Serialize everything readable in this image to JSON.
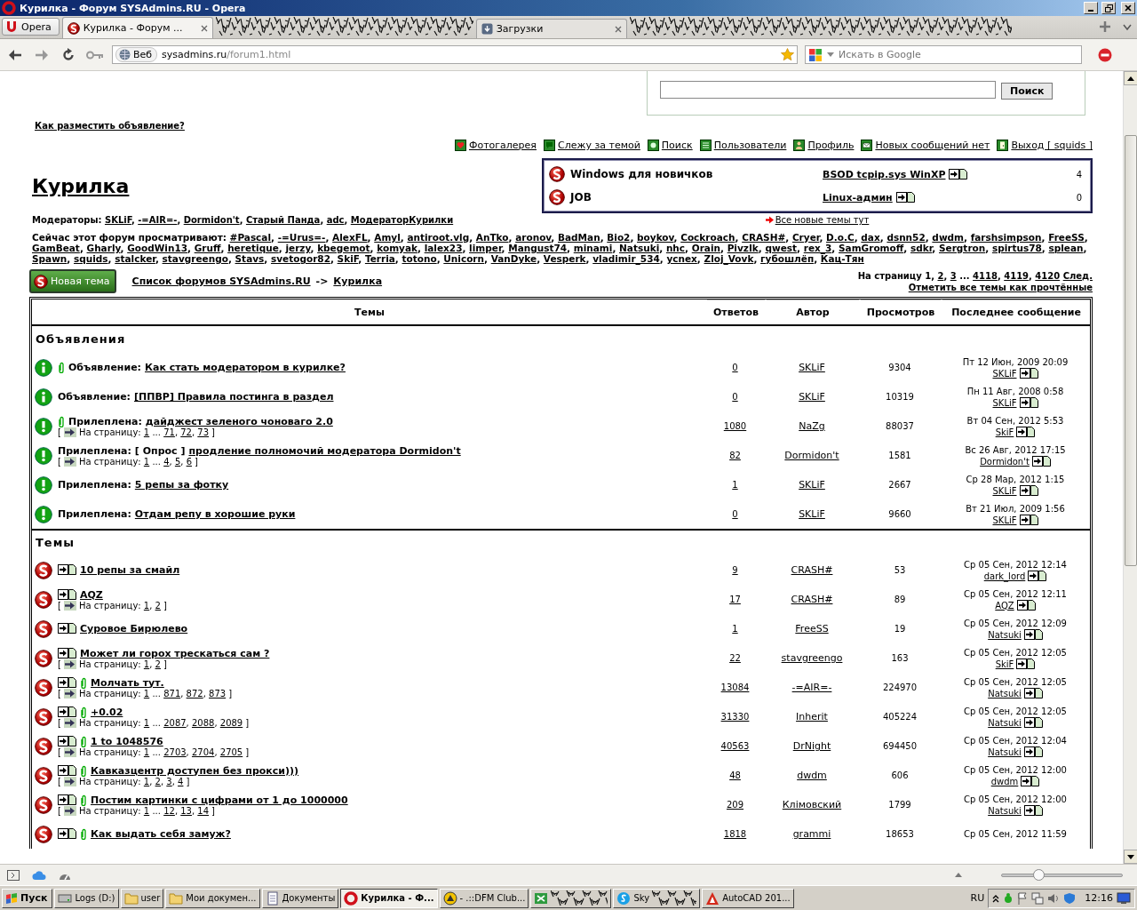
{
  "window": {
    "title": "Курилка - Форум SYSAdmins.RU - Opera"
  },
  "browser": {
    "menu_button": "Opera",
    "tabs": [
      {
        "kind": "tab",
        "label": "Курилка - Форум ...",
        "selected": true
      },
      {
        "kind": "redacted"
      },
      {
        "kind": "tab",
        "label": "Загрузки",
        "selected": false
      },
      {
        "kind": "redacted"
      }
    ],
    "address": {
      "badge": "Веб",
      "host": "sysadmins.ru",
      "path": "/forum1.html"
    },
    "search": {
      "placeholder": "Искать в Google"
    }
  },
  "page": {
    "search_button": "Поиск",
    "post_ad_link": "Как разместить объявление?",
    "nav_links": [
      {
        "kind": "gallery",
        "label": "Фотогалерея"
      },
      {
        "kind": "watch",
        "label": "Слежу за темой"
      },
      {
        "kind": "search",
        "label": "Поиск"
      },
      {
        "kind": "users",
        "label": "Пользователи"
      },
      {
        "kind": "profile",
        "label": "Профиль"
      },
      {
        "kind": "messages",
        "label": "Новых сообщений нет"
      },
      {
        "kind": "logout",
        "label": "Выход [ squids ]"
      }
    ],
    "forum_title": "Курилка",
    "related_forums": [
      {
        "name": "Windows для новичков",
        "last_topic": "BSOD tcpip.sys WinXP",
        "count": "4"
      },
      {
        "name": "JOB",
        "last_topic": "Linux-админ",
        "count": "0"
      }
    ],
    "moderators": {
      "label": "Модераторы:",
      "separator": ", ",
      "names": [
        "SKLiF",
        "-=AIR=-",
        "Dormidon't",
        "Старый Панда",
        "adc",
        "МодераторКурилки"
      ]
    },
    "new_topics_link": "Все новые темы тут",
    "viewers": {
      "label": "Сейчас этот форум просматривают:",
      "separator": ", ",
      "names": [
        "#Pascal",
        "-=Urus=-",
        "AlexFL",
        "Amyl",
        "antiroot.vlg",
        "AnTko",
        "aronov",
        "BadMan",
        "Bio2",
        "boykov",
        "Cockroach",
        "CRASH#",
        "Cryer",
        "D.o.C",
        "dax",
        "dsnn52",
        "dwdm",
        "farshsimpson",
        "FreeSS",
        "GamBeat",
        "Gharly",
        "GoodWin13",
        "Gruff",
        "heretique",
        "jerzy",
        "kbegemot",
        "komyak",
        "lalex23",
        "limper",
        "Mangust74",
        "minami",
        "Natsuki",
        "nhc",
        "Orain",
        "PivzIk",
        "qwest",
        "rex_3",
        "SamGromoff",
        "sdkr",
        "Sergtron",
        "spirtus78",
        "splean",
        "Spawn",
        "squids",
        "stalcker",
        "stavgreengo",
        "Stavs",
        "svetogor82",
        "SkiF",
        "Terria",
        "totono",
        "Unicorn",
        "VanDyke",
        "Vesperk",
        "vladimir_534",
        "ycnex",
        "Zloj_Vovk",
        "губошлёп",
        "Кац-Тян"
      ]
    },
    "new_topic_button": "Новая тема",
    "breadcrumb": {
      "forum_list": "Список форумов SYSAdmins.RU",
      "separator": "->",
      "current": "Курилка"
    },
    "pagination": {
      "label": "На страницу",
      "separator": ", ",
      "pages": [
        {
          "kind": "current",
          "label": "1"
        },
        {
          "kind": "page",
          "label": "2"
        },
        {
          "kind": "page",
          "label": "3"
        },
        {
          "kind": "gap",
          "label": "..."
        },
        {
          "kind": "page",
          "label": "4118"
        },
        {
          "kind": "page",
          "label": "4119"
        },
        {
          "kind": "page",
          "label": "4120"
        }
      ],
      "next": "След."
    },
    "mark_read_link": "Отметить все темы как прочтённые"
  },
  "table": {
    "columns": [
      "Темы",
      "Ответов",
      "Автор",
      "Просмотров",
      "Последнее сообщение"
    ],
    "sections": [
      {
        "title": "Объявления",
        "rows": [
          {
            "kind": "announcement",
            "attachment": true,
            "prefix": "Объявление:",
            "title": "Как стать модератором в курилке?",
            "replies": "0",
            "author": "SKLiF",
            "views": "9304",
            "last_post": {
              "date": "Пт 12 Июн, 2009 20:09",
              "author": "SKLiF"
            }
          },
          {
            "kind": "announcement",
            "attachment": false,
            "prefix": "Объявление:",
            "title": "[ППВР] Правила постинга в раздел",
            "replies": "0",
            "author": "SKLiF",
            "views": "10319",
            "last_post": {
              "date": "Пн 11 Авг, 2008 0:58",
              "author": "SKLiF"
            }
          },
          {
            "kind": "sticky",
            "attachment": true,
            "prefix": "Прилеплена:",
            "title": "дайджест зеленого чоноваго 2.0",
            "jump": {
              "open": "[",
              "label": "На страницу:",
              "separator": ", ",
              "pages": [
                {
                  "kind": "page",
                  "label": "1"
                },
                {
                  "kind": "gap",
                  "label": "..."
                },
                {
                  "kind": "page",
                  "label": "71"
                },
                {
                  "kind": "page",
                  "label": "72"
                },
                {
                  "kind": "page",
                  "label": "73"
                }
              ],
              "close": "]"
            },
            "replies": "1080",
            "author": "NaZg",
            "views": "88037",
            "last_post": {
              "date": "Вт 04 Сен, 2012 5:53",
              "author": "SkiF"
            }
          },
          {
            "kind": "sticky",
            "attachment": false,
            "prefix": "Прилеплена:",
            "poll": "[ Опрос ]",
            "title": "продление полномочий модератора Dormidon't",
            "jump": {
              "open": "[",
              "label": "На страницу:",
              "separator": ", ",
              "pages": [
                {
                  "kind": "page",
                  "label": "1"
                },
                {
                  "kind": "gap",
                  "label": "..."
                },
                {
                  "kind": "page",
                  "label": "4"
                },
                {
                  "kind": "page",
                  "label": "5"
                },
                {
                  "kind": "page",
                  "label": "6"
                }
              ],
              "close": "]"
            },
            "replies": "82",
            "author": "Dormidon't",
            "views": "1581",
            "last_post": {
              "date": "Вс 26 Авг, 2012 17:15",
              "author": "Dormidon't"
            }
          },
          {
            "kind": "sticky",
            "attachment": false,
            "prefix": "Прилеплена:",
            "title": "5 репы за фотку",
            "replies": "1",
            "author": "SKLiF",
            "views": "2667",
            "last_post": {
              "date": "Ср 28 Мар, 2012 1:15",
              "author": "SKLiF"
            }
          },
          {
            "kind": "sticky",
            "attachment": false,
            "prefix": "Прилеплена:",
            "title": "Отдам репу в хорошие руки",
            "replies": "0",
            "author": "SKLiF",
            "views": "9660",
            "last_post": {
              "date": "Вт 21 Июл, 2009 1:56",
              "author": "SKLiF"
            }
          }
        ]
      },
      {
        "title": "Темы",
        "rows": [
          {
            "kind": "topic",
            "attachment": false,
            "title": "10 репы за смайл",
            "replies": "9",
            "author": "CRASH#",
            "views": "53",
            "last_post": {
              "date": "Ср 05 Сен, 2012 12:14",
              "author": "dark_lord"
            }
          },
          {
            "kind": "topic",
            "attachment": false,
            "title": "AQZ",
            "jump": {
              "open": "[",
              "label": "На страницу:",
              "separator": ", ",
              "pages": [
                {
                  "kind": "page",
                  "label": "1"
                },
                {
                  "kind": "page",
                  "label": "2"
                }
              ],
              "close": "]"
            },
            "replies": "17",
            "author": "CRASH#",
            "views": "89",
            "last_post": {
              "date": "Ср 05 Сен, 2012 12:11",
              "author": "AQZ"
            }
          },
          {
            "kind": "topic",
            "attachment": false,
            "title": "Суровое Бирюлево",
            "replies": "1",
            "author": "FreeSS",
            "views": "19",
            "last_post": {
              "date": "Ср 05 Сен, 2012 12:09",
              "author": "Natsuki"
            }
          },
          {
            "kind": "topic",
            "attachment": false,
            "title": "Может ли горох трескаться сам ?",
            "jump": {
              "open": "[",
              "label": "На страницу:",
              "separator": ", ",
              "pages": [
                {
                  "kind": "page",
                  "label": "1"
                },
                {
                  "kind": "page",
                  "label": "2"
                }
              ],
              "close": "]"
            },
            "replies": "22",
            "author": "stavgreengo",
            "views": "163",
            "last_post": {
              "date": "Ср 05 Сен, 2012 12:05",
              "author": "SkiF"
            }
          },
          {
            "kind": "topic",
            "attachment": true,
            "title": "Молчать тут.",
            "jump": {
              "open": "[",
              "label": "На страницу:",
              "separator": ", ",
              "pages": [
                {
                  "kind": "page",
                  "label": "1"
                },
                {
                  "kind": "gap",
                  "label": "..."
                },
                {
                  "kind": "page",
                  "label": "871"
                },
                {
                  "kind": "page",
                  "label": "872"
                },
                {
                  "kind": "page",
                  "label": "873"
                }
              ],
              "close": "]"
            },
            "replies": "13084",
            "author": "-=AIR=-",
            "views": "224970",
            "last_post": {
              "date": "Ср 05 Сен, 2012 12:05",
              "author": "Natsuki"
            }
          },
          {
            "kind": "topic",
            "attachment": true,
            "title": "+0.02",
            "jump": {
              "open": "[",
              "label": "На страницу:",
              "separator": ", ",
              "pages": [
                {
                  "kind": "page",
                  "label": "1"
                },
                {
                  "kind": "gap",
                  "label": "..."
                },
                {
                  "kind": "page",
                  "label": "2087"
                },
                {
                  "kind": "page",
                  "label": "2088"
                },
                {
                  "kind": "page",
                  "label": "2089"
                }
              ],
              "close": "]"
            },
            "replies": "31330",
            "author": "Inherit",
            "views": "405224",
            "last_post": {
              "date": "Ср 05 Сен, 2012 12:05",
              "author": "Natsuki"
            }
          },
          {
            "kind": "topic",
            "attachment": true,
            "title": "1 to 1048576",
            "jump": {
              "open": "[",
              "label": "На страницу:",
              "separator": ", ",
              "pages": [
                {
                  "kind": "page",
                  "label": "1"
                },
                {
                  "kind": "gap",
                  "label": "..."
                },
                {
                  "kind": "page",
                  "label": "2703"
                },
                {
                  "kind": "page",
                  "label": "2704"
                },
                {
                  "kind": "page",
                  "label": "2705"
                }
              ],
              "close": "]"
            },
            "replies": "40563",
            "author": "DrNight",
            "views": "694450",
            "last_post": {
              "date": "Ср 05 Сен, 2012 12:04",
              "author": "Natsuki"
            }
          },
          {
            "kind": "topic",
            "attachment": true,
            "title": "Кавказцентр доступен без прокси)))",
            "jump": {
              "open": "[",
              "label": "На страницу:",
              "separator": ", ",
              "pages": [
                {
                  "kind": "page",
                  "label": "1"
                },
                {
                  "kind": "page",
                  "label": "2"
                },
                {
                  "kind": "page",
                  "label": "3"
                },
                {
                  "kind": "page",
                  "label": "4"
                }
              ],
              "close": "]"
            },
            "replies": "48",
            "author": "dwdm",
            "views": "606",
            "last_post": {
              "date": "Ср 05 Сен, 2012 12:00",
              "author": "dwdm"
            }
          },
          {
            "kind": "topic",
            "attachment": true,
            "title": "Постим картинки с цифрами от 1 до 1000000",
            "jump": {
              "open": "[",
              "label": "На страницу:",
              "separator": ", ",
              "pages": [
                {
                  "kind": "page",
                  "label": "1"
                },
                {
                  "kind": "gap",
                  "label": "..."
                },
                {
                  "kind": "page",
                  "label": "12"
                },
                {
                  "kind": "page",
                  "label": "13"
                },
                {
                  "kind": "page",
                  "label": "14"
                }
              ],
              "close": "]"
            },
            "replies": "209",
            "author": "Клiмовский",
            "views": "1799",
            "last_post": {
              "date": "Ср 05 Сен, 2012 12:00",
              "author": "Natsuki"
            }
          },
          {
            "kind": "topic",
            "attachment": true,
            "title": "Как выдать себя замуж?",
            "replies": "1818",
            "author": "grammi",
            "views": "18653",
            "last_post": {
              "date": "Ср 05 Сен, 2012 11:59"
            }
          }
        ]
      }
    ]
  },
  "status_bar": {
    "zoom": {
      "level": 0.3
    }
  },
  "taskbar": {
    "start": "Пуск",
    "items": [
      {
        "kind": "drive",
        "label": "Logs (D:)",
        "selected": false,
        "redacted": false
      },
      {
        "kind": "folder",
        "label": "user",
        "selected": false,
        "redacted": false
      },
      {
        "kind": "folder",
        "label": "Мои докумен...",
        "selected": false,
        "redacted": false
      },
      {
        "kind": "docs",
        "label": "Документы",
        "selected": false,
        "redacted": false
      },
      {
        "kind": "opera",
        "label": "Курилка - Ф...",
        "selected": true,
        "redacted": false
      },
      {
        "kind": "dfm",
        "label": "- .::DFM Club...",
        "selected": false,
        "redacted": false
      },
      {
        "kind": "sheet",
        "selected": false,
        "redacted": true
      },
      {
        "kind": "skype",
        "label": "Sky",
        "selected": false,
        "redacted": true
      },
      {
        "kind": "autocad",
        "label": "AutoCAD 201...",
        "selected": false,
        "redacted": false
      }
    ],
    "language": "RU",
    "clock": "12:16"
  }
}
